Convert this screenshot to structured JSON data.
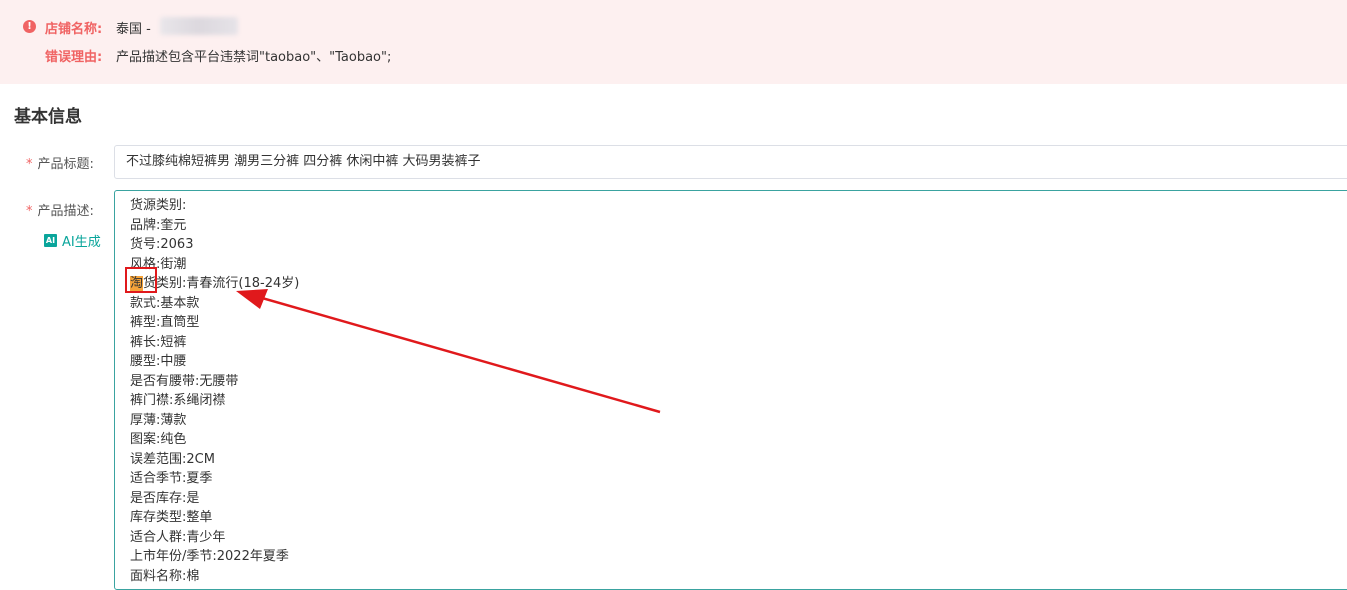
{
  "error_banner": {
    "store_label": "店铺名称:",
    "store_value": "泰国 -",
    "reason_label": "错误理由:",
    "reason_value": "产品描述包含平台违禁词\"taobao\"、\"Taobao\";"
  },
  "section": {
    "title": "基本信息"
  },
  "form": {
    "required_mark": "*",
    "title_label": "产品标题:",
    "title_value": "不过膝纯棉短裤男 潮男三分裤 四分裤 休闲中裤 大码男装裤子",
    "desc_label": "产品描述:",
    "ai_badge": "AI",
    "ai_label": "AI生成",
    "highlight_char": "淘",
    "highlight_rest": "货类别:青春流行(18-24岁)",
    "desc_lines": [
      "货源类别:",
      "品牌:奎元",
      "货号:2063",
      "风格:街潮",
      "",
      "款式:基本款",
      "裤型:直筒型",
      "裤长:短裤",
      "腰型:中腰",
      "是否有腰带:无腰带",
      "裤门襟:系绳闭襟",
      "厚薄:薄款",
      "图案:纯色",
      "误差范围:2CM",
      "适合季节:夏季",
      "是否库存:是",
      "库存类型:整单",
      "适合人群:青少年",
      "上市年份/季节:2022年夏季",
      "面料名称:棉"
    ]
  },
  "colors": {
    "error": "#f06363",
    "accent": "#0aa59b",
    "annotation": "#e0191c",
    "highlight": "#f5a33a"
  }
}
